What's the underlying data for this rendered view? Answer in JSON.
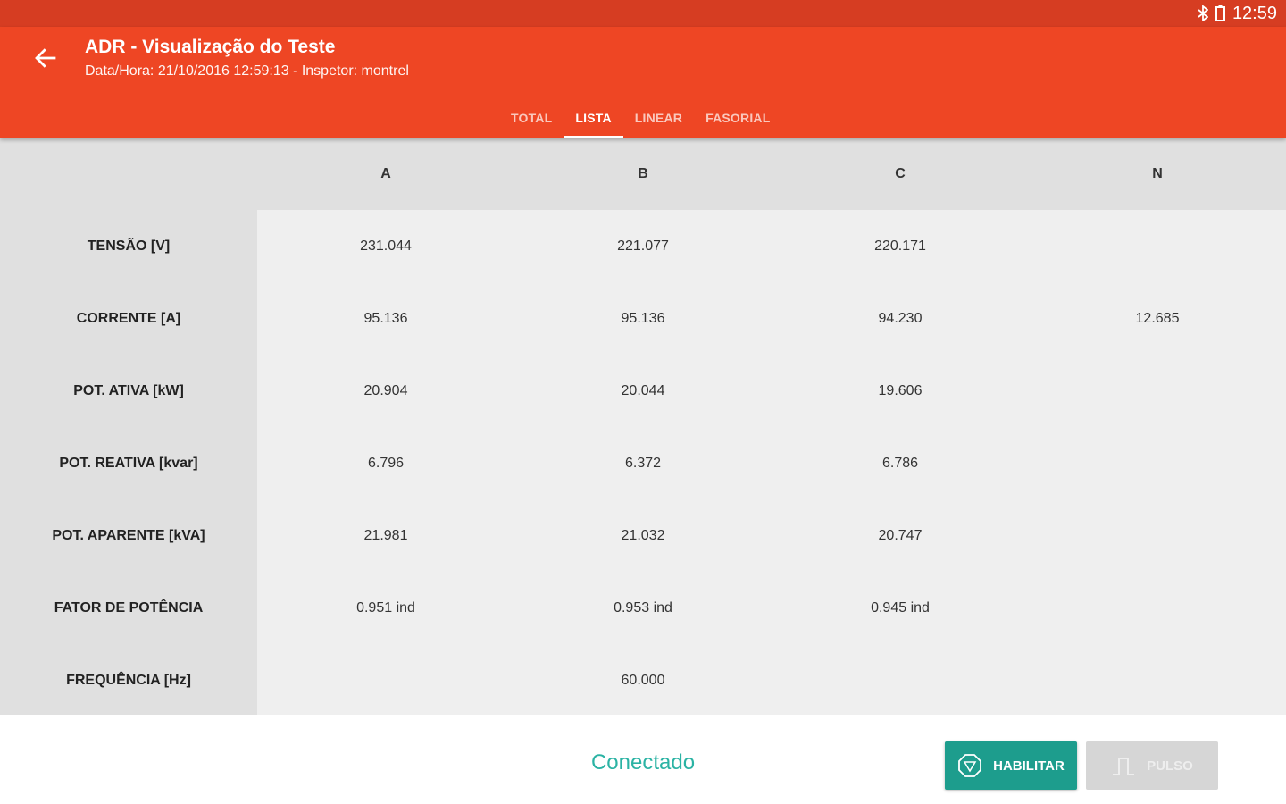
{
  "status_bar": {
    "time": "12:59",
    "bluetooth_icon": "bluetooth-icon",
    "battery_icon": "battery-icon"
  },
  "toolbar": {
    "title": "ADR - Visualização do Teste",
    "subtitle": "Data/Hora: 21/10/2016 12:59:13 - Inspetor: montrel",
    "back_icon": "arrow-left-icon",
    "tabs": [
      {
        "label": "TOTAL",
        "active": false
      },
      {
        "label": "LISTA",
        "active": true
      },
      {
        "label": "LINEAR",
        "active": false
      },
      {
        "label": "FASORIAL",
        "active": false
      }
    ]
  },
  "table": {
    "columns": [
      "A",
      "B",
      "C",
      "N"
    ],
    "rows": [
      {
        "label": "TENSÃO [V]",
        "values": [
          "231.044",
          "221.077",
          "220.171",
          ""
        ]
      },
      {
        "label": "CORRENTE [A]",
        "values": [
          "95.136",
          "95.136",
          "94.230",
          "12.685"
        ]
      },
      {
        "label": "POT. ATIVA [kW]",
        "values": [
          "20.904",
          "20.044",
          "19.606",
          ""
        ]
      },
      {
        "label": "POT. REATIVA [kvar]",
        "values": [
          "6.796",
          "6.372",
          "6.786",
          ""
        ]
      },
      {
        "label": "POT. APARENTE [kVA]",
        "values": [
          "21.981",
          "21.032",
          "20.747",
          ""
        ]
      },
      {
        "label": "FATOR DE POTÊNCIA",
        "values": [
          "0.951 ind",
          "0.953 ind",
          "0.945 ind",
          ""
        ]
      },
      {
        "label": "FREQUÊNCIA [Hz]",
        "values": [
          "",
          "60.000",
          "",
          ""
        ]
      }
    ]
  },
  "bottom": {
    "connection_status": "Conectado",
    "enable_button": {
      "label": "HABILITAR",
      "icon": "stop-sign-icon"
    },
    "pulse_button": {
      "label": "PULSO",
      "icon": "pulse-wave-icon",
      "enabled": false
    }
  },
  "colors": {
    "primary": "#ee4624",
    "primary_dark": "#d63d22",
    "accent": "#1d9d8d",
    "status_text": "#2bb3a4"
  }
}
